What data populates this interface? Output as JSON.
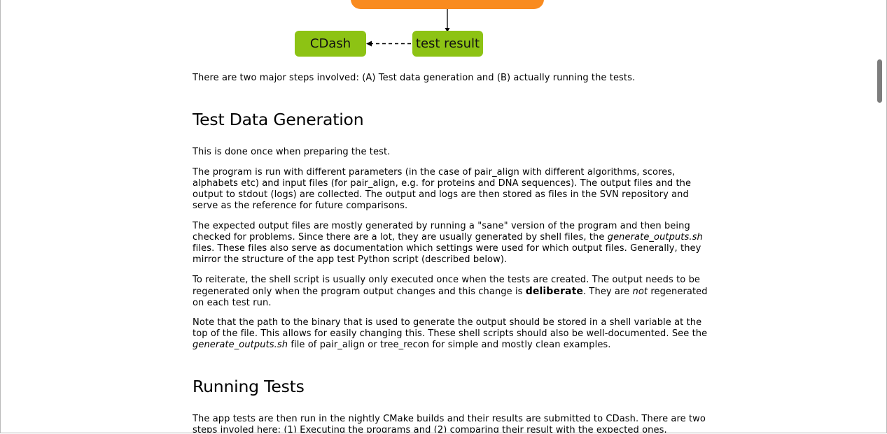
{
  "diagram": {
    "cdash_label": "CDash",
    "result_label": "test result",
    "colors": {
      "orange": "#f98b1f",
      "green": "#8dc314"
    }
  },
  "intro": "There are two major steps involved: (A) Test data generation and (B) actually running the tests.",
  "section1": {
    "heading": "Test Data Generation",
    "p1": "This is done once when preparing the test.",
    "p2": "The program is run with different parameters (in the case of pair_align with different algorithms, scores, alphabets etc) and input files (for pair_align, e.g. for proteins and DNA sequences). The output files and the output to stdout (logs) are collected. The output and logs are then stored as files in the SVN repository and serve as the reference for future comparisons.",
    "p3_a": "The expected output files are mostly generated by running a \"sane\" version of the program and then being checked for problems. Since there are a lot, they are usually generated by shell files, the ",
    "p3_em": "generate_outputs.sh",
    "p3_b": " files. These files also serve as documentation which settings were used for which output files. Generally, they mirror the structure of the app test Python script (described below).",
    "p4_a": "To reiterate, the shell script is usually only executed once when the tests are created. The output needs to be regenerated only when the program output changes and this change is ",
    "p4_strong": "deliberate",
    "p4_b": ". They are ",
    "p4_em": "not",
    "p4_c": " regenerated on each test run.",
    "p5_a": "Note that the path to the binary that is used to generate the output should be stored in a shell variable at the top of the file. This allows for easily changing this. These shell scripts should also be well-documented. See the ",
    "p5_em": "generate_outputs.sh",
    "p5_b": " file of pair_align or tree_recon for simple and mostly clean examples."
  },
  "section2": {
    "heading": "Running Tests",
    "p1": "The app tests are then run in the nightly CMake builds and their results are submitted to CDash. There are two steps involed here: (1) Executing the programs and (2) comparing their result with the expected ones."
  }
}
